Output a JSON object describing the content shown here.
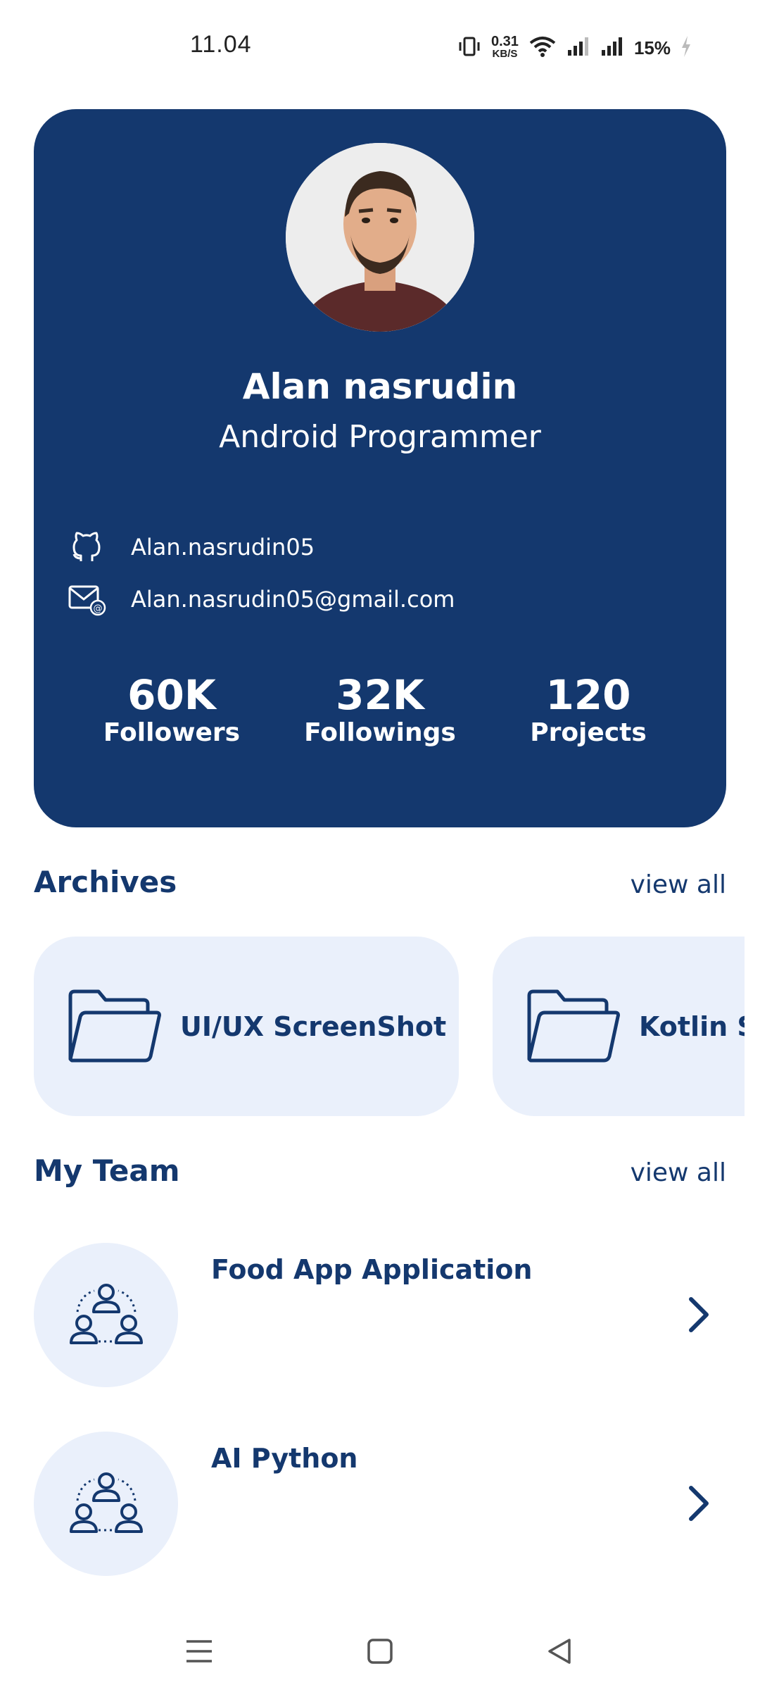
{
  "status_bar": {
    "time": "11.04",
    "speed_value": "0.31",
    "speed_unit": "KB/S",
    "battery": "15%"
  },
  "profile": {
    "name": "Alan nasrudin",
    "role": "Android Programmer",
    "github": "Alan.nasrudin05",
    "email": "Alan.nasrudin05@gmail.com",
    "stats": [
      {
        "value": "60K",
        "label": "Followers"
      },
      {
        "value": "32K",
        "label": "Followings"
      },
      {
        "value": "120",
        "label": "Projects"
      }
    ]
  },
  "archives": {
    "title": "Archives",
    "view_all": "view all",
    "items": [
      {
        "label": "UI/UX ScreenShot",
        "icon": "folder-icon"
      },
      {
        "label": "Kotlin Source",
        "icon": "folder-icon"
      }
    ]
  },
  "team": {
    "title": "My Team",
    "view_all": "view all",
    "items": [
      {
        "name": "Food App Application",
        "icon": "team-icon"
      },
      {
        "name": "AI Python",
        "icon": "team-icon"
      }
    ]
  },
  "colors": {
    "primary": "#14386e",
    "card_light": "#eaf0fb",
    "background": "#ffffff"
  }
}
